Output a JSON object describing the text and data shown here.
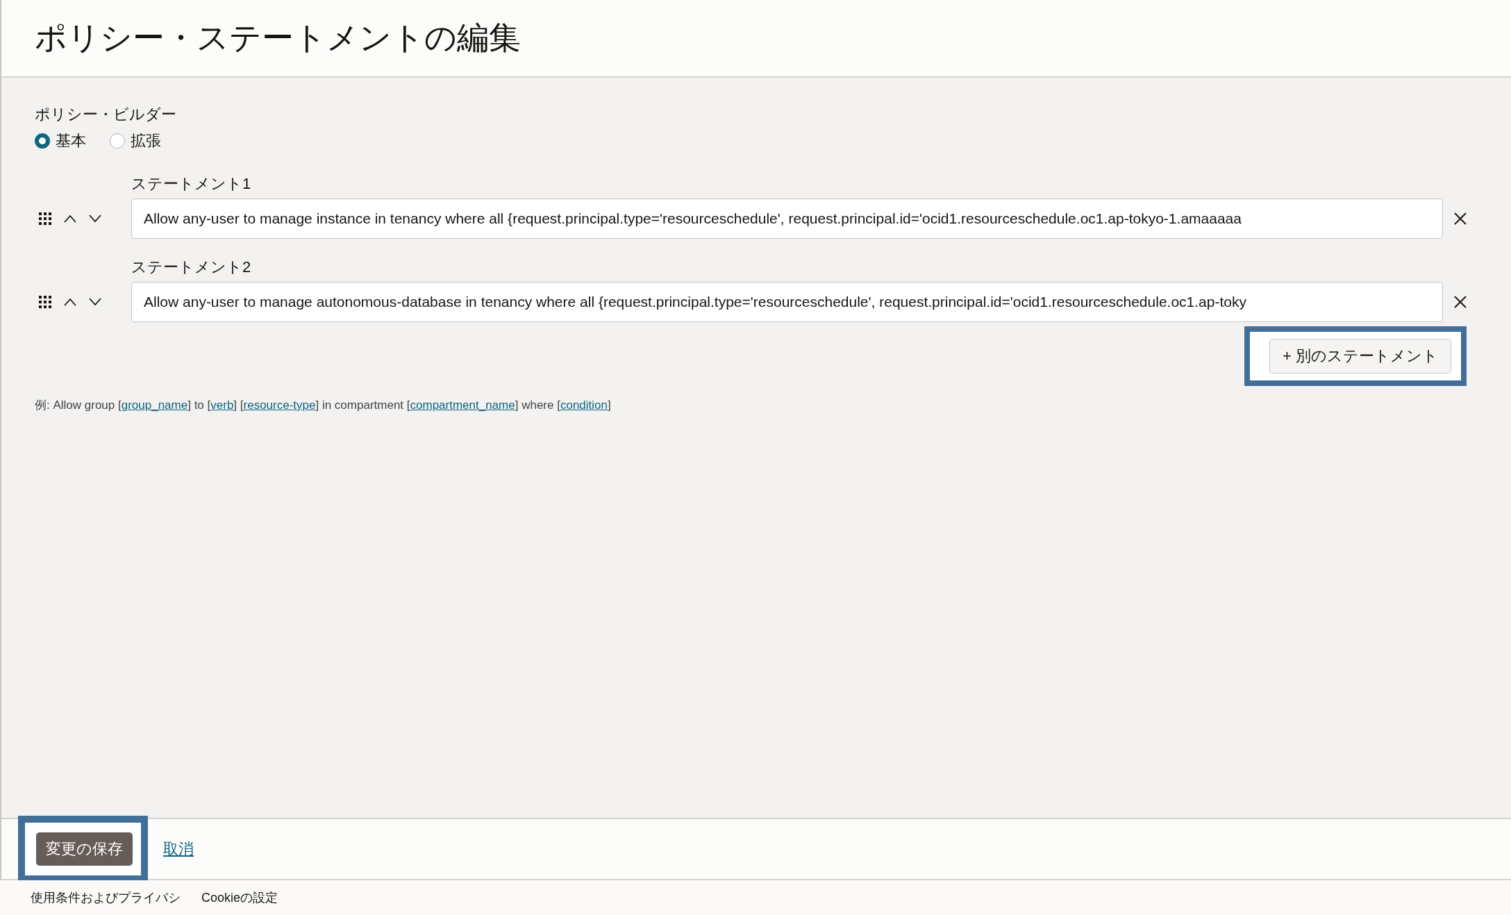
{
  "page_title": "ポリシー・ステートメントの編集",
  "policy_builder": {
    "label": "ポリシー・ビルダー",
    "options": [
      {
        "label": "基本",
        "selected": true
      },
      {
        "label": "拡張",
        "selected": false
      }
    ]
  },
  "statements": [
    {
      "label": "ステートメント1",
      "value": "Allow any-user to manage instance in tenancy where all {request.principal.type='resourceschedule', request.principal.id='ocid1.resourceschedule.oc1.ap-tokyo-1.amaaaaa"
    },
    {
      "label": "ステートメント2",
      "value": "Allow any-user to manage autonomous-database in tenancy where all {request.principal.type='resourceschedule', request.principal.id='ocid1.resourceschedule.oc1.ap-toky"
    }
  ],
  "add_button": {
    "label": "+ 別のステートメント",
    "highlighted": true
  },
  "example": [
    {
      "kind": "text",
      "text": "例: Allow group ["
    },
    {
      "kind": "link",
      "text": "group_name"
    },
    {
      "kind": "text",
      "text": "] to ["
    },
    {
      "kind": "link",
      "text": "verb"
    },
    {
      "kind": "text",
      "text": "] ["
    },
    {
      "kind": "link",
      "text": "resource-type"
    },
    {
      "kind": "text",
      "text": "] in compartment ["
    },
    {
      "kind": "link",
      "text": "compartment_name"
    },
    {
      "kind": "text",
      "text": "] where ["
    },
    {
      "kind": "link",
      "text": "condition"
    },
    {
      "kind": "text",
      "text": "]"
    }
  ],
  "footer_actions": {
    "save": {
      "label": "変更の保存",
      "highlighted": true
    },
    "cancel": "取消"
  },
  "page_footer": [
    "使用条件およびプライバシ",
    "Cookieの設定"
  ]
}
